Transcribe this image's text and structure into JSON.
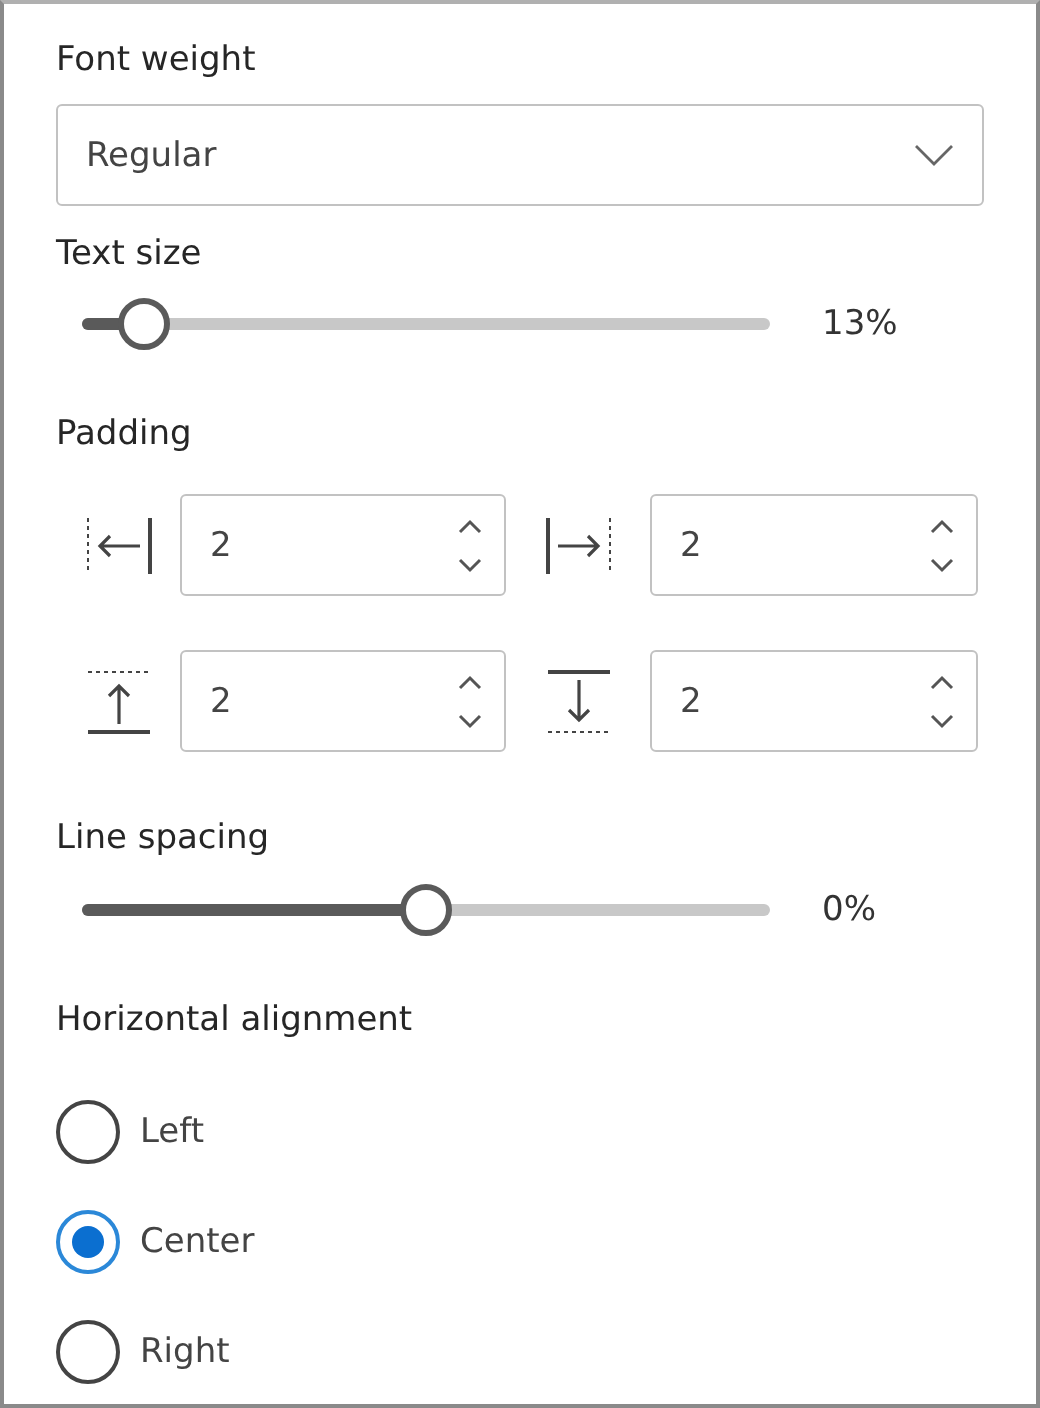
{
  "font_weight": {
    "label": "Font weight",
    "value": "Regular"
  },
  "text_size": {
    "label": "Text size",
    "level": 0.09,
    "reading": "13%"
  },
  "padding": {
    "label": "Padding",
    "fields": [
      {
        "kind": "left",
        "value": "2"
      },
      {
        "kind": "right",
        "value": "2"
      },
      {
        "kind": "top",
        "value": "2"
      },
      {
        "kind": "bottom",
        "value": "2"
      }
    ]
  },
  "line_spacing": {
    "label": "Line spacing",
    "level": 0.5,
    "reading": "0%"
  },
  "horizontal_alignment": {
    "label": "Horizontal alignment",
    "options": [
      {
        "label": "Left",
        "selected": false
      },
      {
        "label": "Center",
        "selected": true
      },
      {
        "label": "Right",
        "selected": false
      }
    ]
  }
}
